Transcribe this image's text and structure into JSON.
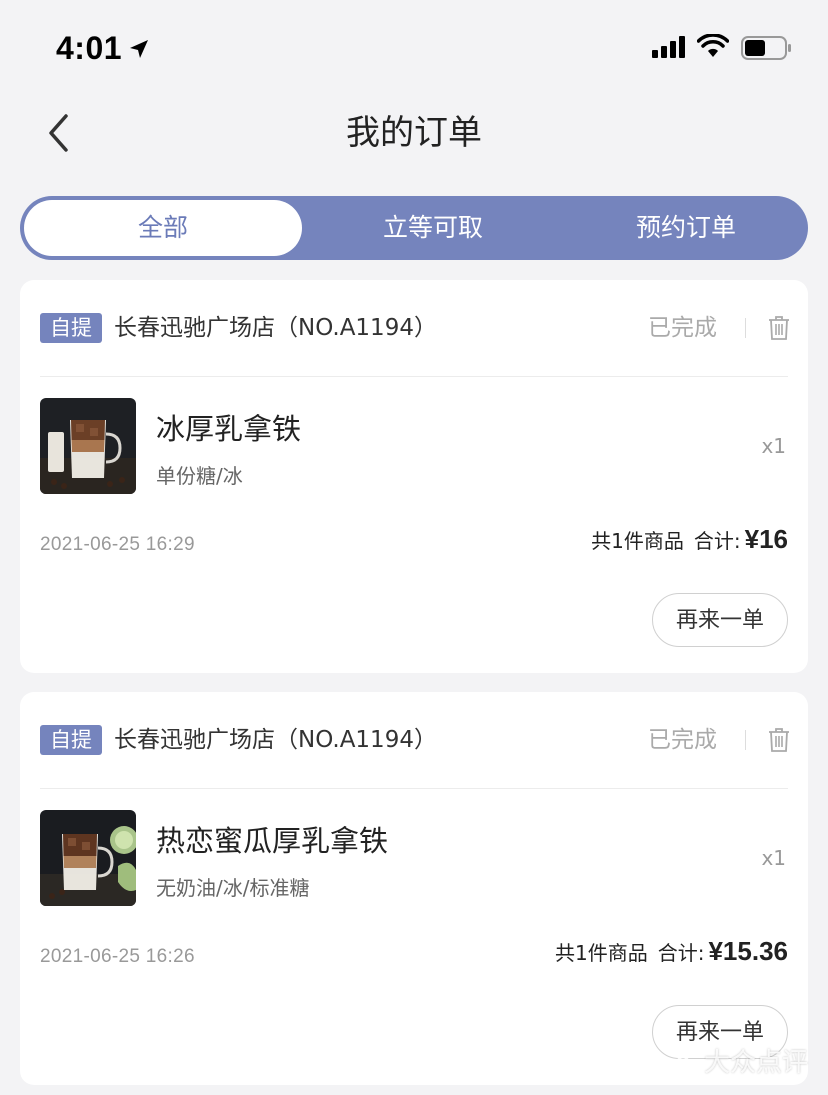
{
  "status_bar": {
    "time": "4:01"
  },
  "nav": {
    "title": "我的订单"
  },
  "tabs": [
    {
      "label": "全部"
    },
    {
      "label": "立等可取"
    },
    {
      "label": "预约订单"
    }
  ],
  "orders": [
    {
      "badge": "自提",
      "store": "长春迅驰广场店（NO.A1194）",
      "status": "已完成",
      "product_name": "冰厚乳拿铁",
      "product_options": "单份糖/冰",
      "quantity": "x1",
      "time": "2021-06-25 16:29",
      "count_label": "共1件商品",
      "total_label": "合计:",
      "total_price": "¥16",
      "reorder_label": "再来一单"
    },
    {
      "badge": "自提",
      "store": "长春迅驰广场店（NO.A1194）",
      "status": "已完成",
      "product_name": "热恋蜜瓜厚乳拿铁",
      "product_options": "无奶油/冰/标准糖",
      "quantity": "x1",
      "time": "2021-06-25 16:26",
      "count_label": "共1件商品",
      "total_label": "合计:",
      "total_price": "¥15.36",
      "reorder_label": "再来一单"
    }
  ],
  "watermark": "大众点评",
  "colors": {
    "accent": "#7584bd",
    "background": "#f3f3f5"
  }
}
